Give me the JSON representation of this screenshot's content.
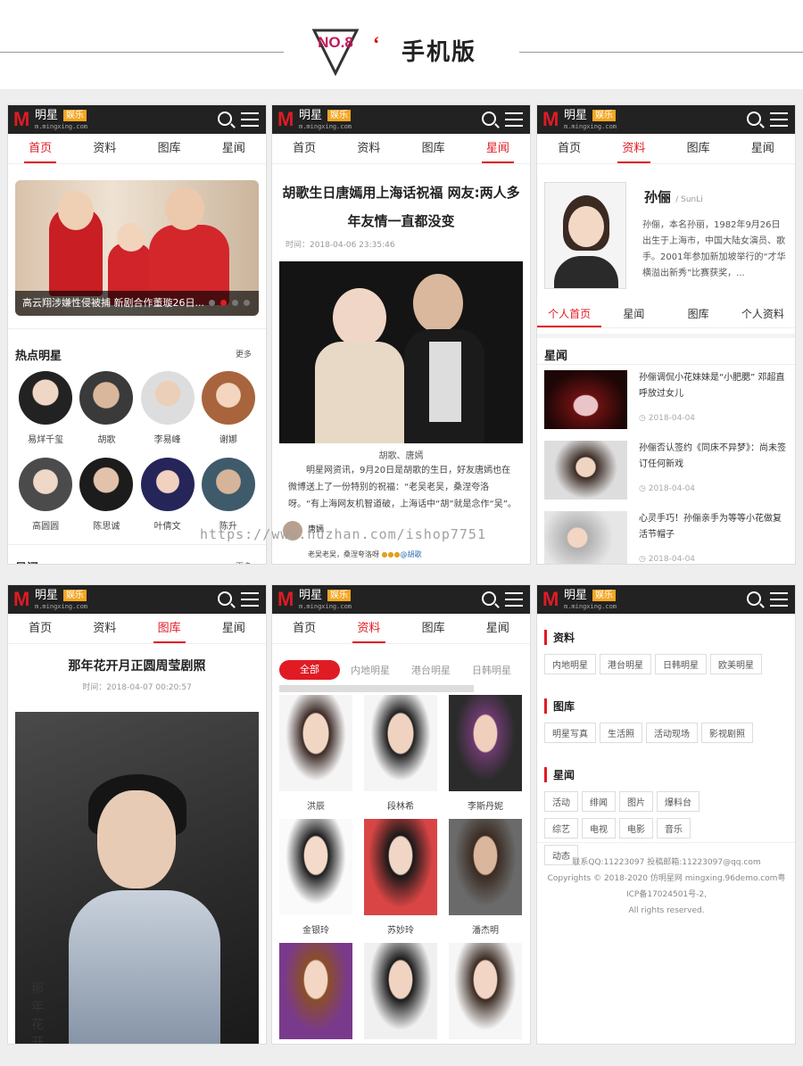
{
  "header": {
    "badge": "NO.8",
    "title": "手机版"
  },
  "brand": {
    "name": "明星",
    "tag": "娱乐",
    "url": "m.mingxing.com"
  },
  "nav": [
    "首页",
    "资料",
    "图库",
    "星闻"
  ],
  "p1": {
    "slide_caption": "高云翔涉嫌性侵被捕 新剧合作董璇26日...",
    "hot_title": "热点明星",
    "more": "更多",
    "stars": [
      "易烊千玺",
      "胡歌",
      "李易峰",
      "谢娜",
      "高圆圆",
      "陈思诚",
      "叶倩文",
      "陈升"
    ],
    "next_section": "星闻",
    "next_more": "更多"
  },
  "p2": {
    "title": "胡歌生日唐嫣用上海话祝福 网友:两人多年友情一直都没变",
    "time": "时间：2018-04-06 23:35:46",
    "img_caption": "胡歌、唐嫣",
    "body": "明星网资讯，9月20日是胡歌的生日，好友唐嫣也在微博送上了一份特别的祝福：“老吴老吴，桑涅夸洛呀。“有上海网友机智道破，上海话中“胡”就是念作“吴”。",
    "weibo_user": "唐嫣",
    "weibo_text": "老吴老吴，桑涅夸洛呀",
    "weibo_at": "@胡歌"
  },
  "p3": {
    "name": "孙俪",
    "en": "/ SunLi",
    "bio": "孙俪，本名孙丽，1982年9月26日出生于上海市，中国大陆女演员、歌手。2001年参加新加坡举行的“才华横溢出新秀”比赛获奖，...",
    "tabs": [
      "个人首页",
      "星闻",
      "图库",
      "个人资料"
    ],
    "news_title": "星闻",
    "news": [
      {
        "title": "孙俪调侃小花妹妹是“小肥腮” 邓超直呼放过女儿",
        "date": "2018-04-04"
      },
      {
        "title": "孙俪否认签约《同床不异梦》：尚未签订任何新戏",
        "date": "2018-04-04"
      },
      {
        "title": "心灵手巧！孙俪亲手为等等小花做复活节帽子",
        "date": "2018-04-04"
      }
    ]
  },
  "p4": {
    "title": "那年花开月正圆周莹剧照",
    "time": "时间：2018-04-07 00:20:57",
    "poster_text": "那年花开月正圆"
  },
  "p5": {
    "filters": [
      "全部",
      "内地明星",
      "港台明星",
      "日韩明星"
    ],
    "people": [
      "洪辰",
      "段林希",
      "李斯丹妮",
      "金银玲",
      "苏妙玲",
      "潘杰明",
      "",
      "",
      ""
    ]
  },
  "p6": {
    "groups": [
      {
        "title": "资料",
        "tags": [
          "内地明星",
          "港台明星",
          "日韩明星",
          "欧美明星"
        ]
      },
      {
        "title": "图库",
        "tags": [
          "明星写真",
          "生活照",
          "活动现场",
          "影视剧照"
        ]
      },
      {
        "title": "星闻",
        "tags": [
          "活动",
          "绯闻",
          "图片",
          "爆料台",
          "综艺",
          "电视",
          "电影",
          "音乐",
          "动态"
        ]
      }
    ],
    "footer": [
      "联系QQ:11223097 投稿邮箱:11223097@qq.com",
      "Copyrights © 2018-2020 仿明星网 mingxing.96demo.com粤ICP备17024501号-2,",
      "All rights reserved."
    ]
  },
  "watermark": "https://www.huzhan.com/ishop7751",
  "colors": {
    "accent": "#e01b24",
    "topbar": "#222222",
    "logo_tag": "#f5a623",
    "badge": "#c2185b"
  }
}
